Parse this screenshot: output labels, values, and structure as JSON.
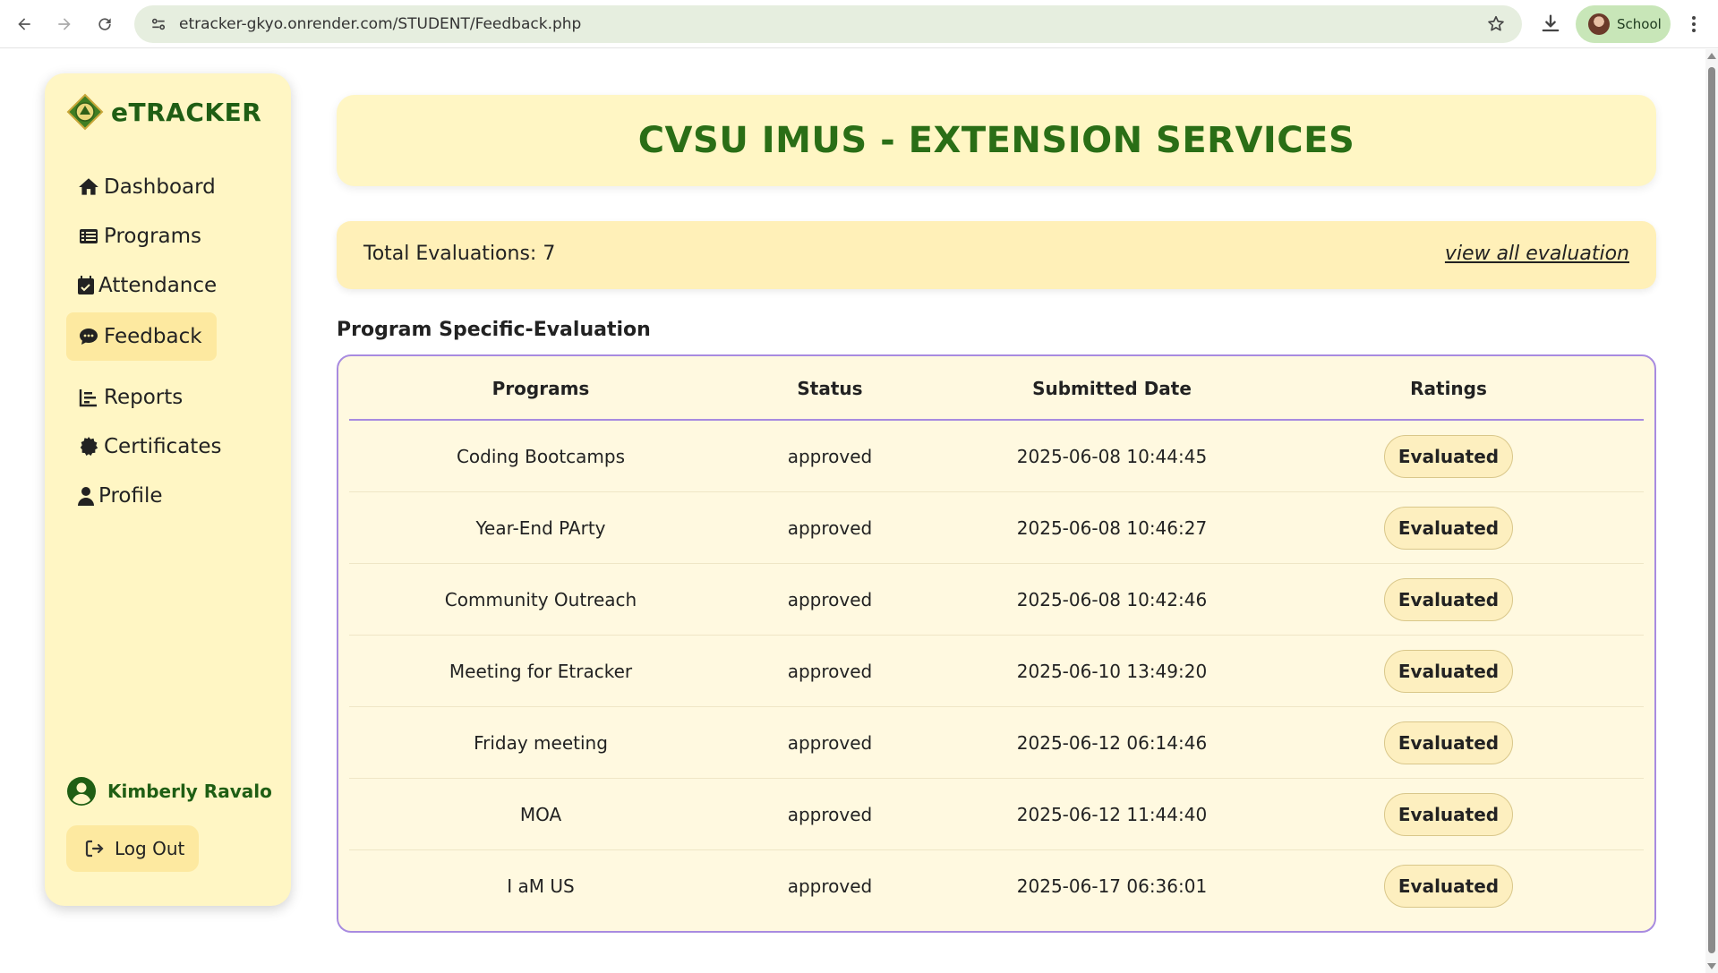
{
  "browser": {
    "url": "etracker-gkyo.onrender.com/STUDENT/Feedback.php",
    "profile_label": "School"
  },
  "sidebar": {
    "brand": "eTRACKER",
    "items": [
      {
        "label": "Dashboard",
        "icon": "home-icon"
      },
      {
        "label": "Programs",
        "icon": "list-icon"
      },
      {
        "label": "Attendance",
        "icon": "calendar-check-icon"
      },
      {
        "label": "Feedback",
        "icon": "comment-dots-icon",
        "active": true
      },
      {
        "label": "Reports",
        "icon": "chart-bar-icon"
      },
      {
        "label": "Certificates",
        "icon": "certificate-icon"
      },
      {
        "label": "Profile",
        "icon": "user-icon"
      }
    ],
    "user_name": "Kimberly Ravalo",
    "logout_label": "Log Out"
  },
  "header": {
    "title": "CVSU IMUS - EXTENSION SERVICES"
  },
  "summary": {
    "total_label": "Total Evaluations: 7",
    "view_all_label": "view all evaluation"
  },
  "section_title": "Program Specific-Evaluation",
  "table": {
    "columns": [
      "Programs",
      "Status",
      "Submitted Date",
      "Ratings"
    ],
    "rows": [
      {
        "program": "Coding Bootcamps",
        "status": "approved",
        "date": "2025-06-08 10:44:45",
        "rating": "Evaluated"
      },
      {
        "program": "Year-End PArty",
        "status": "approved",
        "date": "2025-06-08 10:46:27",
        "rating": "Evaluated"
      },
      {
        "program": "Community Outreach",
        "status": "approved",
        "date": "2025-06-08 10:42:46",
        "rating": "Evaluated"
      },
      {
        "program": "Meeting for Etracker",
        "status": "approved",
        "date": "2025-06-10 13:49:20",
        "rating": "Evaluated"
      },
      {
        "program": "Friday meeting",
        "status": "approved",
        "date": "2025-06-12 06:14:46",
        "rating": "Evaluated"
      },
      {
        "program": "MOA",
        "status": "approved",
        "date": "2025-06-12 11:44:40",
        "rating": "Evaluated"
      },
      {
        "program": "I aM US",
        "status": "approved",
        "date": "2025-06-17 06:36:01",
        "rating": "Evaluated"
      }
    ]
  },
  "colors": {
    "brand_green": "#1f5e14",
    "title_green": "#2a6e16",
    "panel_yellow": "#fff6c4",
    "active_yellow": "#fde9a0",
    "table_border": "#a88be0"
  }
}
